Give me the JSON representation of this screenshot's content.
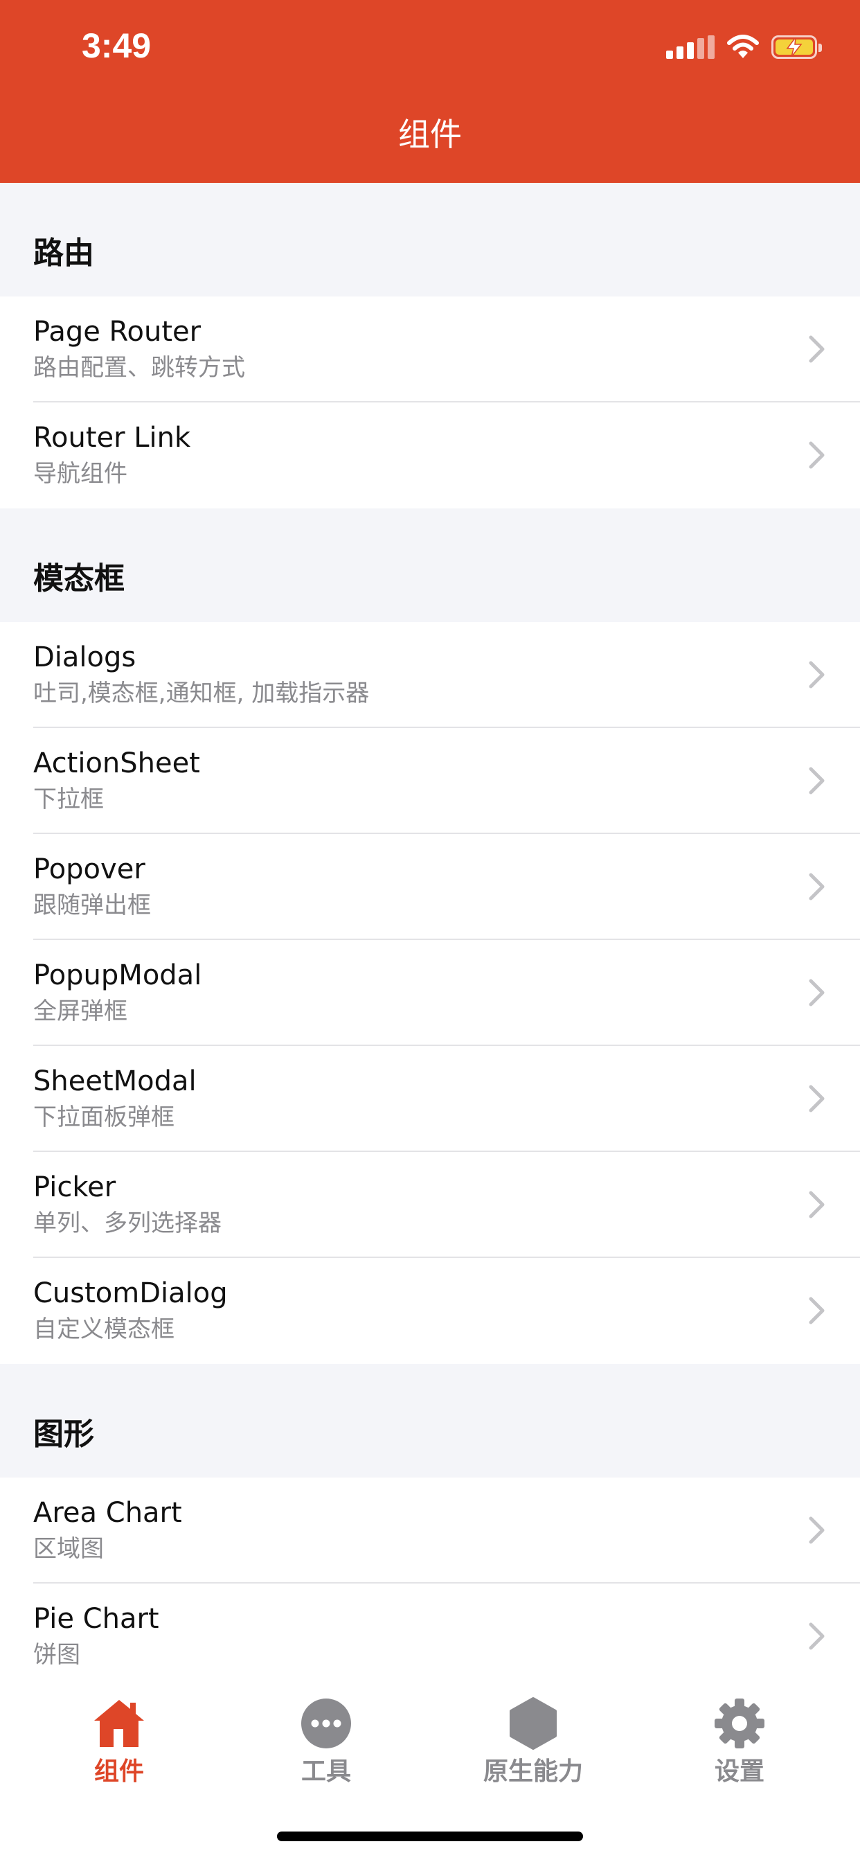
{
  "status_bar": {
    "time": "3:49"
  },
  "header": {
    "title": "组件"
  },
  "sections": [
    {
      "title": "路由",
      "items": [
        {
          "title": "Page Router",
          "subtitle": "路由配置、跳转方式"
        },
        {
          "title": "Router Link",
          "subtitle": "导航组件"
        }
      ]
    },
    {
      "title": "模态框",
      "items": [
        {
          "title": "Dialogs",
          "subtitle": "吐司,模态框,通知框, 加载指示器"
        },
        {
          "title": "ActionSheet",
          "subtitle": "下拉框"
        },
        {
          "title": "Popover",
          "subtitle": "跟随弹出框"
        },
        {
          "title": "PopupModal",
          "subtitle": "全屏弹框"
        },
        {
          "title": "SheetModal",
          "subtitle": "下拉面板弹框"
        },
        {
          "title": "Picker",
          "subtitle": "单列、多列选择器"
        },
        {
          "title": "CustomDialog",
          "subtitle": "自定义模态框"
        }
      ]
    },
    {
      "title": "图形",
      "items": [
        {
          "title": "Area Chart",
          "subtitle": "区域图"
        },
        {
          "title": "Pie Chart",
          "subtitle": "饼图"
        }
      ]
    }
  ],
  "tabbar": {
    "tabs": [
      {
        "label": "组件",
        "icon": "home-icon",
        "active": true
      },
      {
        "label": "工具",
        "icon": "more-dots-icon",
        "active": false
      },
      {
        "label": "原生能力",
        "icon": "hexagon-icon",
        "active": false
      },
      {
        "label": "设置",
        "icon": "gear-icon",
        "active": false
      }
    ]
  },
  "colors": {
    "accent": "#de4628",
    "inactive": "#8a8a8e",
    "background": "#f4f5f9"
  }
}
